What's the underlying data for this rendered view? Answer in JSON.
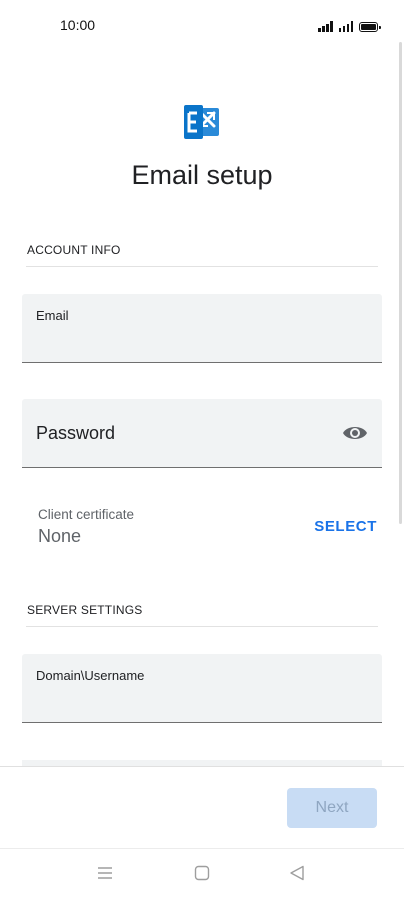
{
  "status_bar": {
    "time": "10:00"
  },
  "header": {
    "title": "Email setup",
    "logo": "exchange-logo"
  },
  "account_section": {
    "header": "ACCOUNT INFO",
    "email_label": "Email",
    "password_label": "Password",
    "password_toggle_icon": "eye-icon"
  },
  "client_certificate": {
    "label": "Client certificate",
    "value": "None",
    "action": "SELECT"
  },
  "server_section": {
    "header": "SERVER SETTINGS",
    "domain_username_label": "Domain\\Username"
  },
  "footer": {
    "next_label": "Next"
  },
  "nav_bar": {
    "icons": [
      "menu-icon",
      "home-square-icon",
      "back-triangle-icon"
    ]
  },
  "colors": {
    "accent": "#1a73e8",
    "field_bg": "#f1f3f4",
    "next_disabled_bg": "#c8dcf4",
    "exchange_blue": "#0a74c9"
  }
}
